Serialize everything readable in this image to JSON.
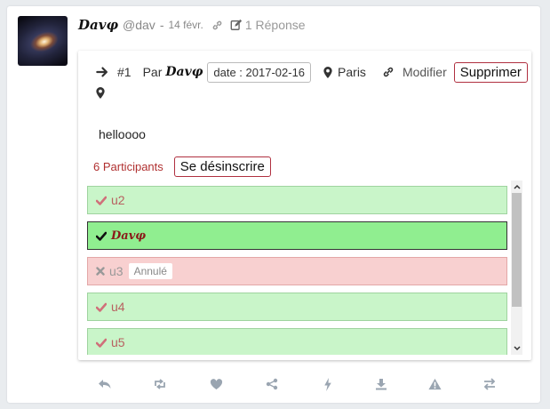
{
  "post": {
    "author": "Davφ",
    "handle": "@dav",
    "separator": "-",
    "date": "14 févr.",
    "replies": "1 Réponse"
  },
  "event": {
    "number": "#1",
    "by_label": "Par",
    "author": "Davφ",
    "date": "date : 2017-02-16",
    "location": "Paris",
    "edit_label": "Modifier",
    "delete_label": "Supprimer",
    "body": "helloooo",
    "participants_label": "6 Participants",
    "unsubscribe_label": "Se désinscrire"
  },
  "participants": [
    {
      "name": "u2",
      "status": "ok"
    },
    {
      "name": "Davφ",
      "status": "active"
    },
    {
      "name": "u3",
      "status": "cancelled",
      "badge": "Annulé"
    },
    {
      "name": "u4",
      "status": "ok"
    },
    {
      "name": "u5",
      "status": "ok"
    }
  ],
  "colors": {
    "accent_red": "#b03040",
    "row_green": "#c9f5c9",
    "row_active": "#90ee90",
    "row_cancel": "#f8d0d0",
    "icon_grey": "#9aa5b1"
  },
  "actions": [
    "reply-icon",
    "retweet-icon",
    "heart-icon",
    "share-icon",
    "bolt-icon",
    "download-icon",
    "warning-icon",
    "transfer-icon"
  ]
}
